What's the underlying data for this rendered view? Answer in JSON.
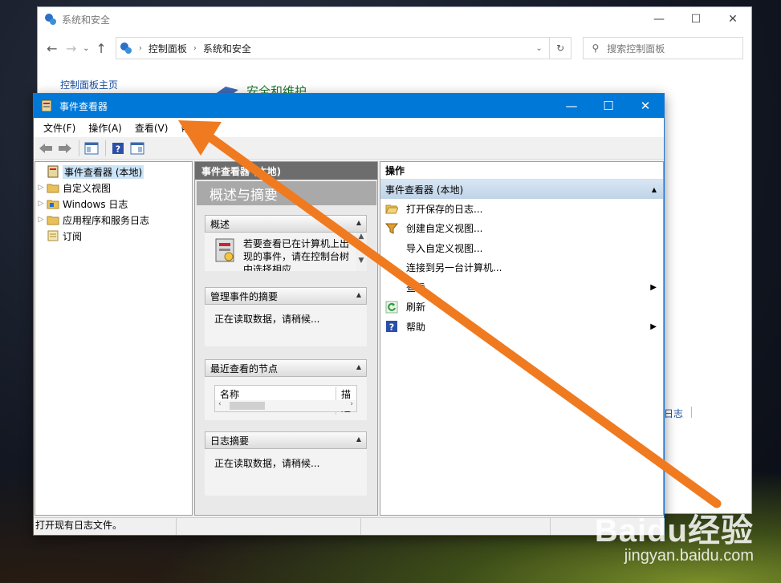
{
  "background_window": {
    "title": "系统和安全",
    "breadcrumbs": [
      "控制面板",
      "系统和安全"
    ],
    "search_placeholder": "搜索控制面板",
    "sidebar_home": "控制面板主页",
    "section_title": "安全和维护",
    "partial_link": "日志"
  },
  "event_viewer": {
    "title": "事件查看器",
    "menu": [
      "文件(F)",
      "操作(A)",
      "查看(V)",
      "帮助(H)"
    ],
    "tree": [
      {
        "label": "事件查看器 (本地)",
        "expandable": false,
        "selected": true
      },
      {
        "label": "自定义视图",
        "expandable": true
      },
      {
        "label": "Windows 日志",
        "expandable": true
      },
      {
        "label": "应用程序和服务日志",
        "expandable": true
      },
      {
        "label": "订阅",
        "expandable": false
      }
    ],
    "middle": {
      "header": "事件查看器 (本地)",
      "banner": "概述与摘要",
      "overview_title": "概述",
      "overview_text": "若要查看已在计算机上出现的事件，请在控制台树中选择相应",
      "admin_summary_title": "管理事件的摘要",
      "admin_summary_text": "正在读取数据，请稍候...",
      "recent_nodes_title": "最近查看的节点",
      "recent_col_name": "名称",
      "recent_col_desc": "描述",
      "log_summary_title": "日志摘要",
      "log_summary_text": "正在读取数据，请稍候..."
    },
    "actions": {
      "header": "操作",
      "group": "事件查看器 (本地)",
      "items": [
        {
          "label": "打开保存的日志...",
          "icon": "folder-open-icon",
          "submenu": false
        },
        {
          "label": "创建自定义视图...",
          "icon": "filter-icon",
          "submenu": false
        },
        {
          "label": "导入自定义视图...",
          "icon": "",
          "submenu": false
        },
        {
          "label": "连接到另一台计算机...",
          "icon": "",
          "submenu": false
        },
        {
          "label": "查看",
          "icon": "",
          "submenu": true
        },
        {
          "label": "刷新",
          "icon": "refresh-icon",
          "submenu": false
        },
        {
          "label": "帮助",
          "icon": "help-icon",
          "submenu": true
        }
      ]
    },
    "status": "打开现有日志文件。"
  },
  "watermark": {
    "logo": "Baidu经验",
    "url": "jingyan.baidu.com"
  },
  "colors": {
    "titlebar": "#0078d7",
    "arrow": "#f07a1f",
    "link": "#1a4fa0",
    "section": "#1e7a2e"
  }
}
